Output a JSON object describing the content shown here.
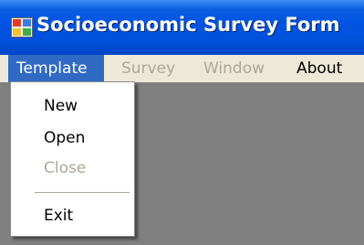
{
  "window": {
    "title": "Socioeconomic Survey Form"
  },
  "menubar": {
    "items": [
      {
        "label": "Template",
        "state": "open"
      },
      {
        "label": "Survey",
        "state": "disabled"
      },
      {
        "label": "Window",
        "state": "disabled"
      },
      {
        "label": "About",
        "state": "enabled"
      }
    ]
  },
  "dropdown": {
    "items": [
      {
        "label": "New",
        "enabled": true
      },
      {
        "label": "Open",
        "enabled": true
      },
      {
        "label": "Close",
        "enabled": false
      },
      {
        "label": "Exit",
        "enabled": true
      }
    ]
  },
  "icons": {
    "app": "app-window-icon"
  },
  "colors": {
    "titlebar": "#0054e3",
    "menu_highlight": "#316ac5",
    "menubar": "#ece9d8",
    "disabled_text": "#aca899",
    "workspace": "#808080"
  }
}
